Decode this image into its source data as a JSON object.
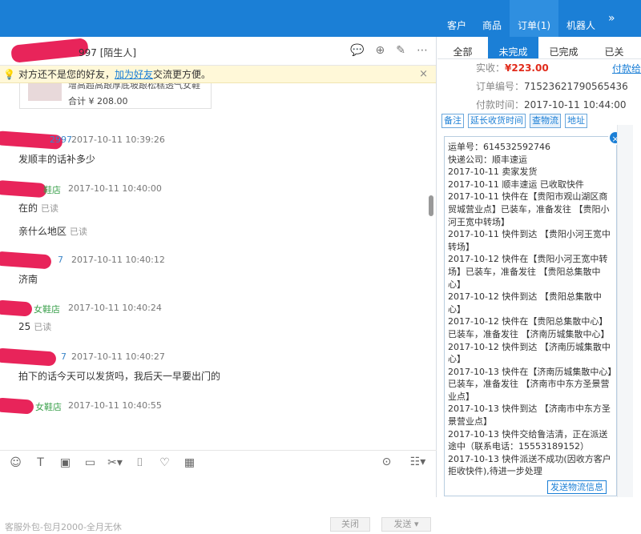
{
  "topnav": {
    "items": [
      "客户",
      "商品",
      "订单(1)",
      "机器人"
    ],
    "more": "»"
  },
  "chat": {
    "contact_name_suffix": "997 [陌生人]",
    "notice": {
      "before": "对方还不是您的好友，",
      "link": "加为好友",
      "after": "交流更方便。"
    },
    "product": {
      "title": "增高超高跟厚底坡跟松糕透气女鞋",
      "total": "合计 ¥ 208.00"
    },
    "messages": [
      {
        "name_frag": "2997",
        "frag_color": "blue",
        "time": "2017-10-11 10:39:26",
        "lines": [
          {
            "text": "发顺丰的话补多少",
            "read": ""
          }
        ]
      },
      {
        "name_frag": "鞋店",
        "frag_color": "green",
        "time": "2017-10-11 10:40:00",
        "lines": [
          {
            "text": "在的",
            "read": "已读"
          },
          {
            "text": "亲什么地区",
            "read": "已读"
          }
        ]
      },
      {
        "name_frag": "7",
        "frag_color": "blue",
        "time": "2017-10-11 10:40:12",
        "lines": [
          {
            "text": "济南",
            "read": ""
          }
        ]
      },
      {
        "name_frag": "女鞋店",
        "frag_color": "green",
        "time": "2017-10-11 10:40:24",
        "lines": [
          {
            "text": "25",
            "read": "已读"
          }
        ]
      },
      {
        "name_frag": "7",
        "frag_color": "blue",
        "time": "2017-10-11 10:40:27",
        "lines": [
          {
            "text": "拍下的话今天可以发货吗，我后天一早要出门的",
            "read": ""
          }
        ]
      },
      {
        "name_frag": "女鞋店",
        "frag_color": "green",
        "time": "2017-10-11 10:40:55",
        "lines": []
      }
    ],
    "tagline": "客服外包-包月2000-全月无休",
    "close_label": "关闭",
    "send_label": "发送"
  },
  "order": {
    "tabs": [
      "全部",
      "未完成",
      "已完成",
      "已关"
    ],
    "paid_label": "实收：",
    "paid_value": "¥223.00",
    "pay_link": "付款给",
    "order_no_label": "订单编号：",
    "order_no": "71523621790565436",
    "pay_time_label": "付款时间：",
    "pay_time": "2017-10-11 10:44:00",
    "actions": [
      "备注",
      "延长收货时间",
      "查物流",
      "地址"
    ],
    "logistics": [
      "运单号：614532592746",
      "快递公司：顺丰速运",
      "2017-10-11 卖家发货",
      "2017-10-11 顺丰速运 已收取快件",
      "2017-10-11 快件在【贵阳市观山湖区商贸城营业点】已装车，准备发往 【贵阳小河王宽中转场】",
      "2017-10-11 快件到达 【贵阳小河王宽中转场】",
      "2017-10-12 快件在【贵阳小河王宽中转场】已装车，准备发往 【贵阳总集散中心】",
      "2017-10-12 快件到达 【贵阳总集散中心】",
      "2017-10-12 快件在【贵阳总集散中心】已装车，准备发往 【济南历城集散中心】",
      "2017-10-12 快件到达 【济南历城集散中心】",
      "2017-10-13 快件在【济南历城集散中心】已装车，准备发往 【济南市中东方圣景营业点】",
      "2017-10-13 快件到达 【济南市中东方圣景营业点】",
      "2017-10-13 快件交给鲁洁清，正在派送途中（联系电话：15553189152）",
      "2017-10-13 快件派送不成功(因收方客户拒收快件),待进一步处理"
    ],
    "send_logistics_label": "发送物流信息",
    "close_x": "×"
  }
}
